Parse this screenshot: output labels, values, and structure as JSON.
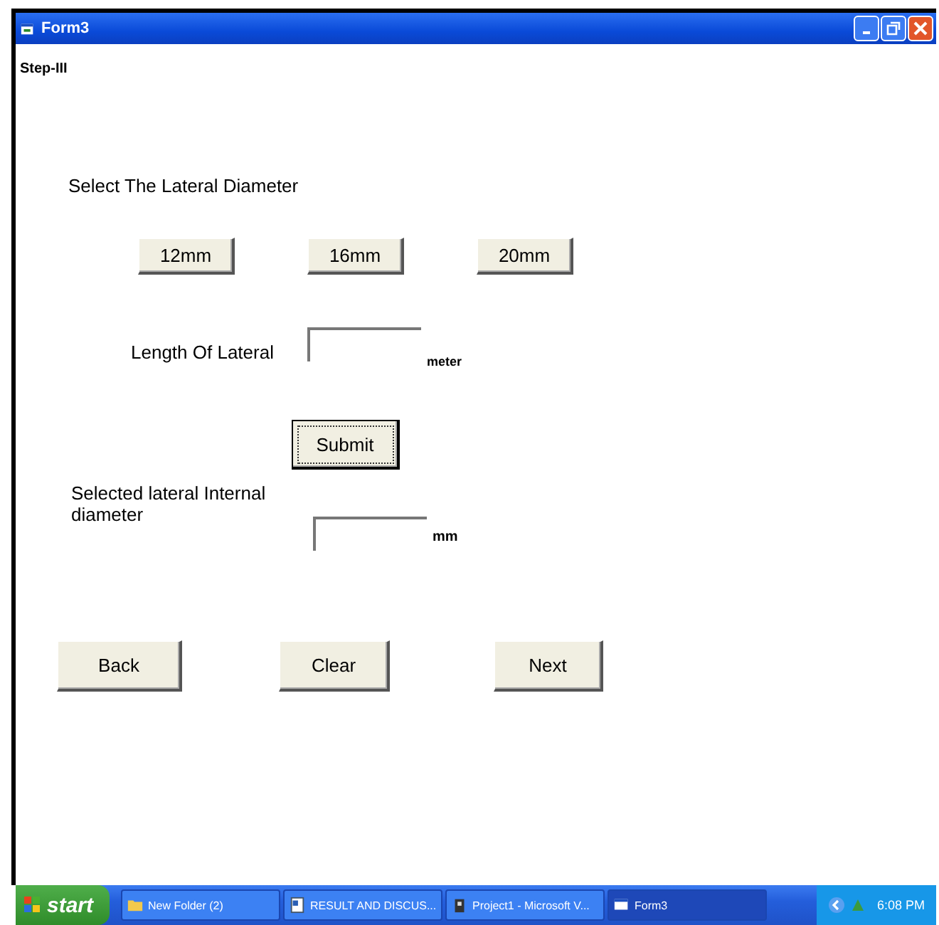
{
  "window": {
    "title": "Form3"
  },
  "step_label": "Step-III",
  "diameter_prompt": "Select The Lateral Diameter",
  "diameter_buttons": [
    "12mm",
    "16mm",
    "20mm"
  ],
  "length": {
    "label": "Length Of Lateral",
    "unit": "meter"
  },
  "submit": {
    "label": "Submit",
    "focused": true
  },
  "internal": {
    "label": "Selected lateral Internal diameter",
    "unit": "mm"
  },
  "nav_buttons": [
    "Back",
    "Clear",
    "Next"
  ],
  "taskbar": {
    "start": "start",
    "items": [
      {
        "label": "New Folder (2)",
        "kind": "folder",
        "selected": false
      },
      {
        "label": "RESULT AND DISCUS...",
        "kind": "document",
        "selected": false
      },
      {
        "label": "Project1 - Microsoft V...",
        "kind": "app",
        "selected": false
      },
      {
        "label": "Form3",
        "kind": "form",
        "selected": true
      }
    ],
    "clock": "6:08 PM"
  }
}
